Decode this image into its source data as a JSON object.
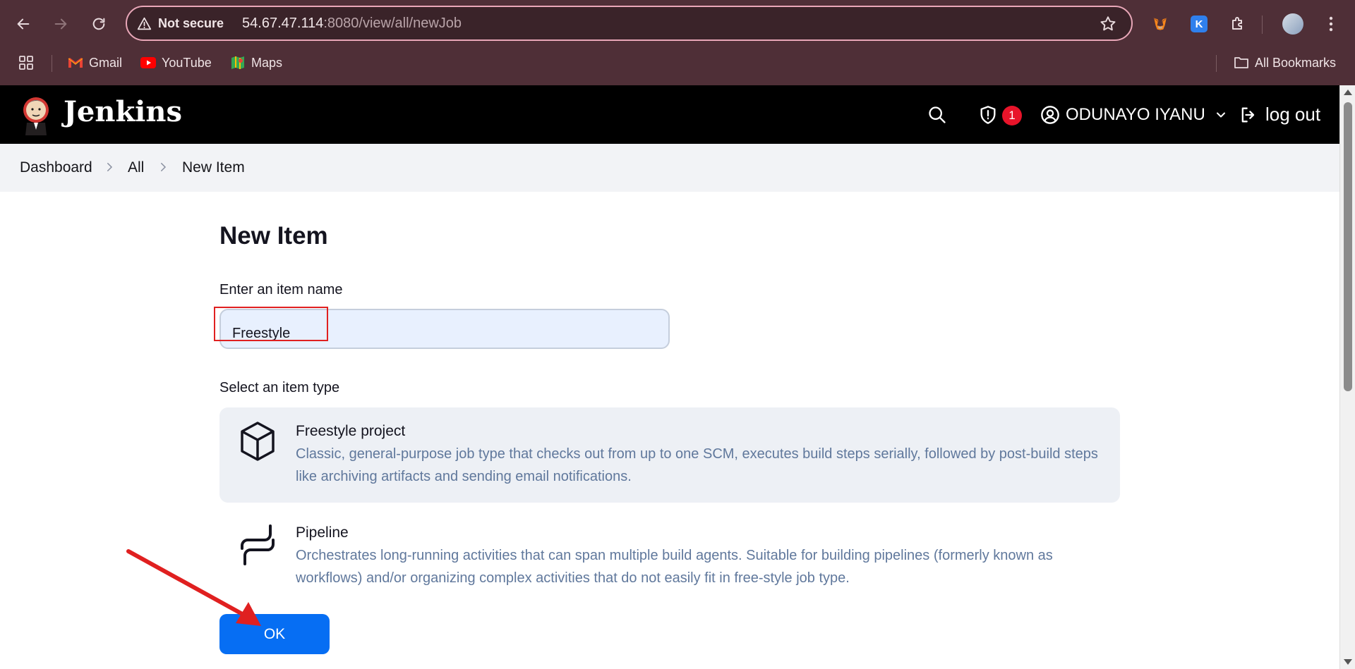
{
  "browser": {
    "not_secure": "Not secure",
    "url_host": "54.67.47.114",
    "url_rest": ":8080/view/all/newJob",
    "bookmarks": [
      {
        "label": "Gmail",
        "icon": "gmail-icon"
      },
      {
        "label": "YouTube",
        "icon": "youtube-icon"
      },
      {
        "label": "Maps",
        "icon": "maps-icon"
      }
    ],
    "all_bookmarks": "All Bookmarks"
  },
  "header": {
    "title": "Jenkins",
    "security_count": "1",
    "user_name": "ODUNAYO IYANU",
    "logout": "log out"
  },
  "breadcrumb": [
    "Dashboard",
    "All",
    "New Item"
  ],
  "main": {
    "page_title": "New Item",
    "name_label": "Enter an item name",
    "name_value": "Freestyle",
    "type_label": "Select an item type",
    "items": [
      {
        "name": "Freestyle project",
        "description": "Classic, general-purpose job type that checks out from up to one SCM, executes build steps serially, followed by post-build steps like archiving artifacts and sending email notifications.",
        "selected": true
      },
      {
        "name": "Pipeline",
        "description": "Orchestrates long-running activities that can span multiple build agents. Suitable for building pipelines (formerly known as workflows) and/or organizing complex activities that do not easily fit in free-style job type.",
        "selected": false
      }
    ],
    "ok_label": "OK"
  },
  "colors": {
    "chrome_bg": "#4f2f37",
    "header_bg": "#000000",
    "ok_button": "#066ef3",
    "annotation_red": "#e02020"
  }
}
